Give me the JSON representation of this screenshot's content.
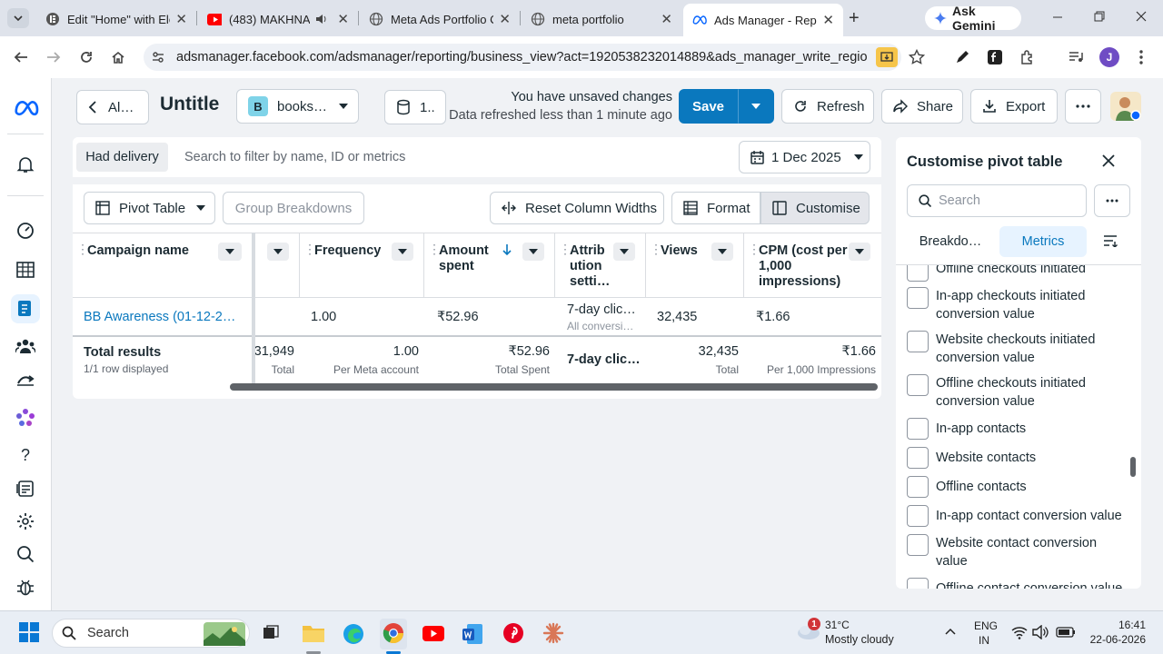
{
  "browser": {
    "tabs": [
      {
        "title": "Edit \"Home\" with Ele",
        "icon": "elementor-icon"
      },
      {
        "title": "(483) MAKHNA",
        "icon": "youtube-icon"
      },
      {
        "title": "Meta Ads Portfolio C",
        "icon": "globe-icon"
      },
      {
        "title": "meta portfolio",
        "icon": "globe-icon"
      },
      {
        "title": "Ads Manager - Repo",
        "icon": "meta-icon"
      }
    ],
    "gemini_label": "Ask Gemini",
    "url": "adsmanager.facebook.com/adsmanager/reporting/business_view?act=1920538232014889&ads_manager_write_regions=…",
    "profile_initial": "J"
  },
  "header": {
    "back_label": "Al…",
    "report_title": "Untitle",
    "account_badge": "B",
    "account_name": "books…",
    "count_label": "1..",
    "unsaved_text": "You have unsaved changes",
    "refreshed_text": "Data refreshed less than 1 minute ago",
    "save_label": "Save",
    "refresh_label": "Refresh",
    "share_label": "Share",
    "export_label": "Export"
  },
  "filter": {
    "chip": "Had delivery",
    "search_placeholder": "Search to filter by name, ID or metrics",
    "date": "1 Dec 2025"
  },
  "toolbar": {
    "pivot_label": "Pivot Table",
    "group_label": "Group Breakdowns",
    "reset_label": "Reset Column Widths",
    "format_label": "Format",
    "customise_label": "Customise"
  },
  "table": {
    "columns": {
      "campaign": "Campaign name",
      "frequency": "Frequency",
      "amount_l1": "Amount",
      "amount_l2": "spent",
      "attr_l1": "Attrib",
      "attr_l2": "ution",
      "attr_l3": "setti…",
      "views": "Views",
      "cpm_l1": "CPM (cost per",
      "cpm_l2": "1,000",
      "cpm_l3": "impressions)"
    },
    "row": {
      "campaign": "BB Awareness (01-12-2…",
      "frequency": "1.00",
      "amount": "₹52.96",
      "attribution": "7-day clic…",
      "attribution_sub": "All conversi…",
      "views": "32,435",
      "cpm": "₹1.66"
    },
    "total": {
      "label": "Total results",
      "sub": "1/1 row displayed",
      "partial_value": "31,949",
      "partial_sub": "Total",
      "frequency": "1.00",
      "frequency_sub": "Per Meta account",
      "amount": "₹52.96",
      "amount_sub": "Total Spent",
      "attribution": "7-day clic…",
      "views": "32,435",
      "views_sub": "Total",
      "cpm": "₹1.66",
      "cpm_sub": "Per 1,000 Impressions"
    }
  },
  "panel": {
    "title": "Customise pivot table",
    "search_placeholder": "Search",
    "tab_breakdowns": "Breakdo…",
    "tab_metrics": "Metrics",
    "metrics_top_cut": "Offline checkouts initiated",
    "metrics": [
      {
        "l1": "In-app checkouts initiated",
        "l2": "conversion value"
      },
      {
        "l1": "Website checkouts initiated",
        "l2": "conversion value"
      },
      {
        "l1": "Offline checkouts initiated",
        "l2": "conversion value"
      },
      {
        "l1": "In-app contacts",
        "l2": ""
      },
      {
        "l1": "Website contacts",
        "l2": ""
      },
      {
        "l1": "Offline contacts",
        "l2": ""
      },
      {
        "l1": "In-app contact conversion value",
        "l2": ""
      },
      {
        "l1": "Website contact conversion",
        "l2": "value"
      }
    ],
    "metrics_bottom_cut": "Offline contact conversion value"
  },
  "taskbar": {
    "search_label": "Search",
    "weather_temp": "31°C",
    "weather_desc": "Mostly cloudy",
    "weather_badge": "1",
    "lang_top": "ENG",
    "lang_bottom": "IN",
    "time": "16:41",
    "date": "22-06-2026"
  },
  "colors": {
    "accent": "#0a78be",
    "meta_blue": "#0866ff",
    "selected_tab_bg": "#e7f3ff"
  }
}
